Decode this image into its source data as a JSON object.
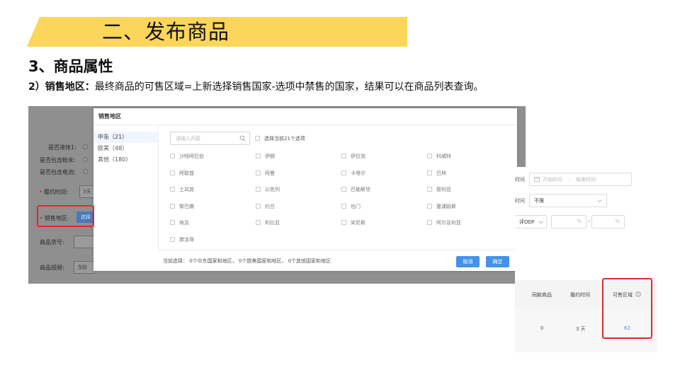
{
  "slide": {
    "title": "二、发布商品",
    "section": "3、商品属性",
    "desc_label": "2）销售地区：",
    "desc_text": "最终商品的可售区域=上新选择销售国家-选项中禁售的国家，结果可以在商品列表查询。",
    "colors": {
      "title_band": "#fbd65a",
      "highlight": "#e02a2a",
      "primary": "#4493e8"
    }
  },
  "form": {
    "liquid_label": "是否液体1:",
    "powder_label": "是否包含粉末:",
    "battery_label": "是否包含电池:",
    "fulfill_label": "履约时间:",
    "fulfill_value": "3天",
    "region_label": "销售地区:",
    "region_select": "选择",
    "sku_label": "商品货号:",
    "video_label": "商品视频:",
    "video_placeholder": "当前"
  },
  "modal": {
    "title": "销售地区",
    "regions": [
      {
        "label": "中东（21）"
      },
      {
        "label": "欧美（48）"
      },
      {
        "label": "其他（180）"
      }
    ],
    "search_placeholder": "请输入内容",
    "select_all": "选择当前21个选项",
    "countries": [
      "沙特阿拉伯",
      "伊朗",
      "伊拉克",
      "科威特",
      "阿联酋",
      "阿曼",
      "卡塔尔",
      "巴林",
      "土耳其",
      "以色列",
      "巴勒斯坦",
      "叙利亚",
      "黎巴嫩",
      "约旦",
      "也门",
      "塞浦路斯",
      "埃及",
      "利比亚",
      "突尼斯",
      "阿尔及利亚",
      "摩洛哥"
    ],
    "footer_text": "当前选择：  0个中东国家和地区，  0个欧美国家和地区，  0个其他国家和地区",
    "cancel": "取消",
    "confirm": "确定"
  },
  "right_panel": {
    "time_label": "时间",
    "start_placeholder": "开始时间",
    "separator": "-",
    "end_placeholder": "结束时间",
    "limit_label": "时间",
    "limit_value": "不限",
    "odr_label": "评ODF",
    "pct1": "%",
    "dash": "-",
    "pct2": "%",
    "table": {
      "headers": [
        "同款商品",
        "履约时间",
        "可售区域"
      ],
      "row": [
        "0",
        "3 天",
        "62"
      ]
    }
  }
}
